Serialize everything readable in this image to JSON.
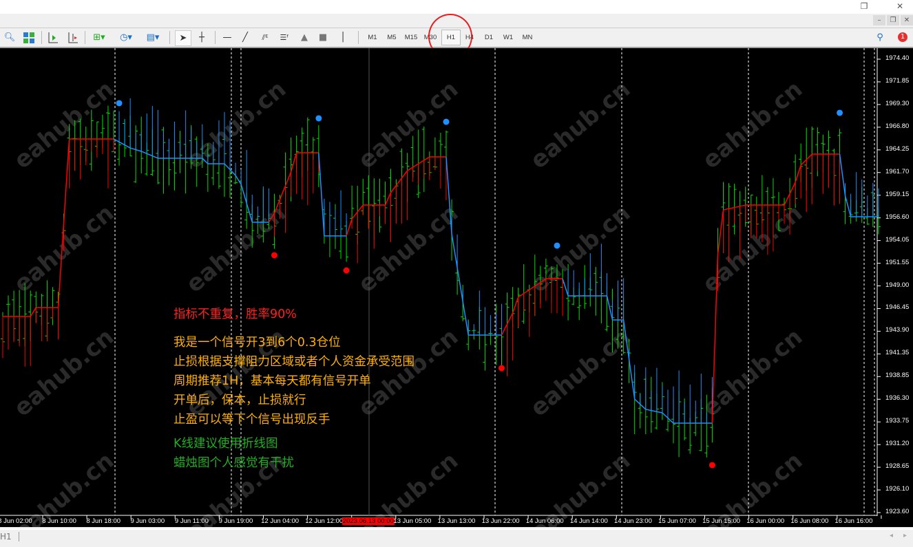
{
  "window": {
    "restore_icon": "❐",
    "close_icon": "✕",
    "mdi_minimize": "–",
    "mdi_restore": "❐",
    "mdi_close": "✕"
  },
  "toolbar": {
    "timeframes": [
      "M1",
      "M5",
      "M15",
      "M30",
      "H1",
      "H4",
      "D1",
      "W1",
      "MN"
    ],
    "active_timeframe": "H1",
    "notification_count": "1"
  },
  "price_axis": [
    "1974.40",
    "1971.85",
    "1969.30",
    "1966.80",
    "1964.25",
    "1961.70",
    "1959.15",
    "1956.60",
    "1954.05",
    "1951.55",
    "1949.00",
    "1946.45",
    "1943.90",
    "1941.35",
    "1938.85",
    "1936.30",
    "1933.75",
    "1931.20",
    "1928.65",
    "1926.10",
    "1923.60"
  ],
  "time_axis": [
    "8 Jun 02:00",
    "8 Jun 10:00",
    "8 Jun 18:00",
    "9 Jun 03:00",
    "9 Jun 11:00",
    "9 Jun 19:00",
    "12 Jun 04:00",
    "12 Jun 12:00",
    "2023.06.13 00:00",
    "13 Jun 05:00",
    "13 Jun 13:00",
    "13 Jun 22:00",
    "14 Jun 06:00",
    "14 Jun 14:00",
    "14 Jun 23:00",
    "15 Jun 07:00",
    "15 Jun 15:00",
    "16 Jun 00:00",
    "16 Jun 08:00",
    "16 Jun 16:00"
  ],
  "crosshair_time": "2023.06.13 00:00",
  "notes": {
    "headline": "指标不重复，胜率90%",
    "lines": [
      "我是一个信号开3到6个0.3仓位",
      "止损根据支撑阻力区域或者个人资金承受范围",
      "周期推荐1H，基本每天都有信号开单",
      "开单后，保本，止损就行",
      "止盈可以等下个信号出现反手"
    ],
    "tips": [
      "K线建议使用折线图",
      "蜡烛图个人感觉有干扰"
    ]
  },
  "watermark": "eahub.cn",
  "bottom_tab": "H1",
  "colors": {
    "bull": "#ff0000",
    "bear": "#1e90ff",
    "bars": "#00e000",
    "headline": "#ff2020",
    "notes": "#ffb000",
    "tips": "#20b020"
  },
  "chart_data": {
    "type": "line",
    "symbol_timeframe": "H1",
    "ylim": [
      1923.6,
      1974.4
    ],
    "indicator_line": [
      [
        0,
        1945.56,
        "r"
      ],
      [
        1,
        1945.56,
        "r"
      ],
      [
        5,
        1945.56,
        "r"
      ],
      [
        6,
        1946.57,
        "r"
      ],
      [
        10,
        1946.57,
        "r"
      ],
      [
        12,
        1965.46,
        "r"
      ],
      [
        20,
        1965.46,
        "r"
      ],
      [
        23,
        1964.45,
        "b"
      ],
      [
        25,
        1964.07,
        "b"
      ],
      [
        28,
        1963.3,
        "b"
      ],
      [
        36,
        1963.3,
        "b"
      ],
      [
        37,
        1962.68,
        "b"
      ],
      [
        40,
        1962.68,
        "b"
      ],
      [
        42,
        1961.37,
        "b"
      ],
      [
        43,
        1960.37,
        "b"
      ],
      [
        45,
        1956.13,
        "b"
      ],
      [
        48,
        1956.13,
        "b"
      ],
      [
        49,
        1957.13,
        "r"
      ],
      [
        52,
        1961.76,
        "r"
      ],
      [
        53,
        1963.91,
        "r"
      ],
      [
        57,
        1963.91,
        "r"
      ],
      [
        58,
        1954.59,
        "b"
      ],
      [
        62,
        1954.59,
        "b"
      ],
      [
        63,
        1956.51,
        "r"
      ],
      [
        65,
        1958.05,
        "r"
      ],
      [
        69,
        1958.05,
        "r"
      ],
      [
        70,
        1959.44,
        "r"
      ],
      [
        73,
        1961.91,
        "r"
      ],
      [
        77,
        1963.45,
        "r"
      ],
      [
        80,
        1963.45,
        "r"
      ],
      [
        81,
        1954.82,
        "b"
      ],
      [
        84,
        1943.48,
        "b"
      ],
      [
        90,
        1943.48,
        "b"
      ],
      [
        92,
        1945.95,
        "r"
      ],
      [
        93,
        1947.72,
        "r"
      ],
      [
        98,
        1949.8,
        "r"
      ],
      [
        101,
        1949.8,
        "r"
      ],
      [
        102,
        1947.88,
        "b"
      ],
      [
        109,
        1947.88,
        "b"
      ],
      [
        110,
        1945.18,
        "b"
      ],
      [
        112,
        1945.18,
        "b"
      ],
      [
        114,
        1936.31,
        "b"
      ],
      [
        116,
        1935.16,
        "b"
      ],
      [
        119,
        1934.77,
        "b"
      ],
      [
        121,
        1933.61,
        "b"
      ],
      [
        128,
        1933.61,
        "b"
      ],
      [
        129,
        1952.5,
        "r"
      ],
      [
        130,
        1957.51,
        "r"
      ],
      [
        134,
        1958.05,
        "r"
      ],
      [
        141,
        1958.05,
        "r"
      ],
      [
        143,
        1960.6,
        "r"
      ],
      [
        144,
        1962.53,
        "r"
      ],
      [
        146,
        1963.76,
        "r"
      ],
      [
        151,
        1963.76,
        "r"
      ],
      [
        152,
        1959.06,
        "b"
      ],
      [
        153,
        1956.74,
        "b"
      ],
      [
        158,
        1956.74,
        "b"
      ]
    ],
    "signals": [
      {
        "bar": 21,
        "price": 1969.47,
        "type": "sell"
      },
      {
        "bar": 57,
        "price": 1967.77,
        "type": "sell"
      },
      {
        "bar": 80,
        "price": 1967.38,
        "type": "sell"
      },
      {
        "bar": 100,
        "price": 1953.51,
        "type": "sell"
      },
      {
        "bar": 151,
        "price": 1968.39,
        "type": "sell"
      },
      {
        "bar": 49,
        "price": 1952.43,
        "type": "buy"
      },
      {
        "bar": 62,
        "price": 1950.73,
        "type": "buy"
      },
      {
        "bar": 90,
        "price": 1939.78,
        "type": "buy"
      },
      {
        "bar": 128,
        "price": 1928.91,
        "type": "buy"
      }
    ]
  }
}
